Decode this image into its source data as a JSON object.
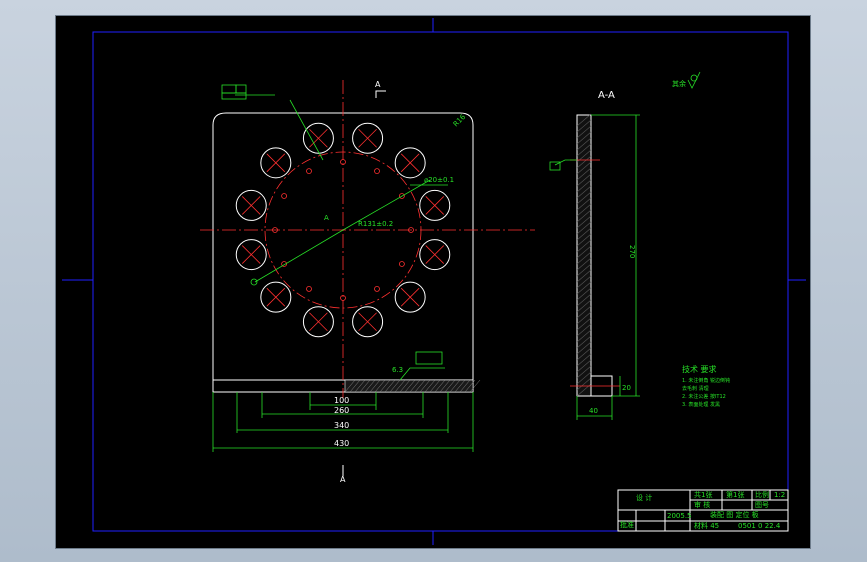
{
  "section_marks": {
    "top": "A",
    "bottom": "A",
    "center": "A"
  },
  "section_view": {
    "title": "A-A",
    "height_dim": "270",
    "thickness_dim": "40",
    "small_dim": "20"
  },
  "front_view": {
    "corner_radius": "R16",
    "pcd_note": "R131±0.2",
    "hole_note": "⌀20±0.1",
    "depth_note": "6.3",
    "dims": [
      "100",
      "260",
      "340",
      "430"
    ]
  },
  "roughness_note": "其余",
  "tech_req": {
    "title": "技术 要求",
    "items": [
      "1. 未注倒角 锐边倒钝",
      "   去毛刺 清理",
      "2. 未注公差 按IT12",
      "3. 表面处理 发黑"
    ]
  },
  "title_block": {
    "cells": [
      "设  计",
      "共1张",
      "第1张",
      "比例",
      "1:2",
      "审 核",
      "图号",
      "批准",
      "2005.5",
      "装配 图 定位 板",
      "材料 45",
      "0501 0 22.4"
    ]
  },
  "colors": {
    "bg": "#000000",
    "frame": "#2020ff",
    "geometry": "#ffffff",
    "centerline": "#ff3030",
    "dimension": "#27e027"
  }
}
